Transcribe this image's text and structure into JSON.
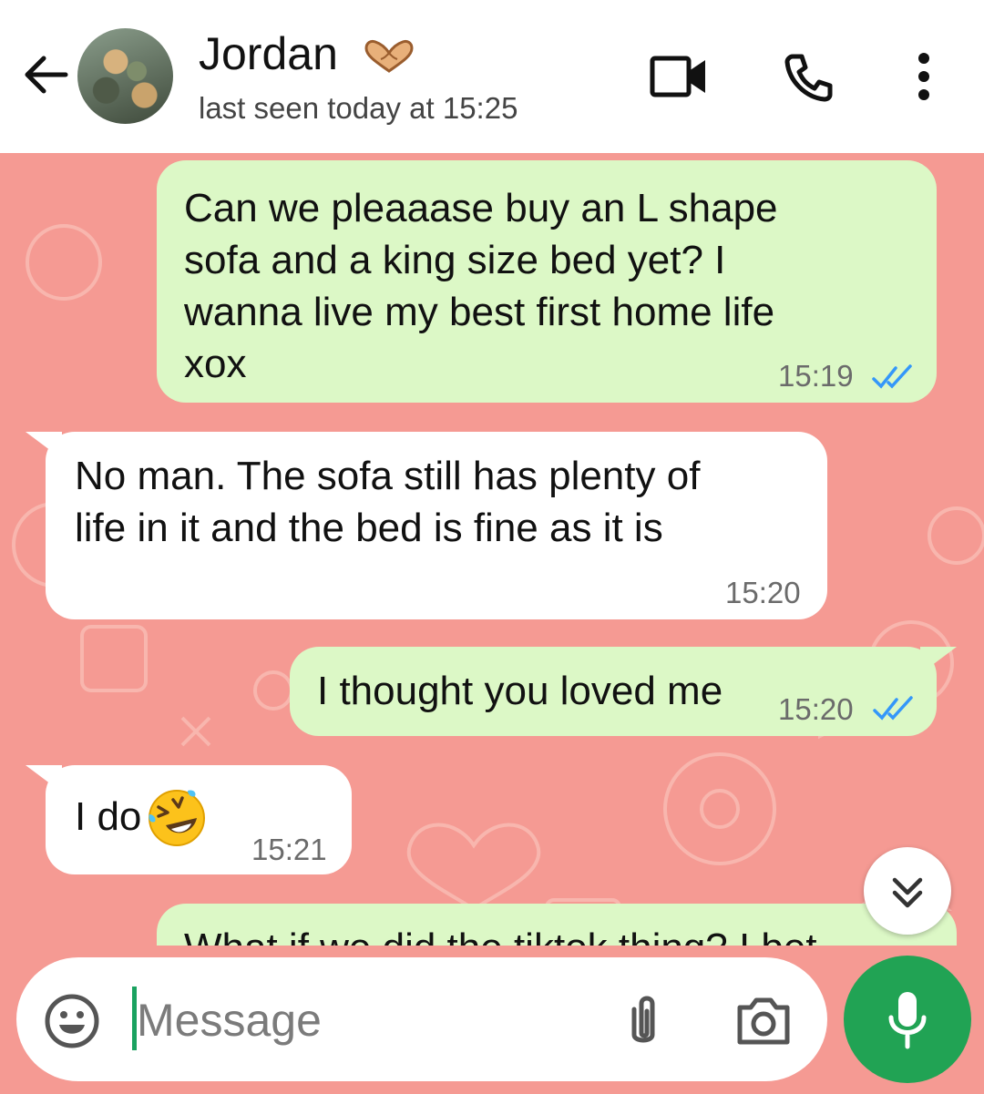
{
  "header": {
    "contact_name": "Jordan",
    "status": "last seen today at 15:25",
    "icons": [
      "back-arrow-icon",
      "heart-hands-icon",
      "video-call-icon",
      "voice-call-icon",
      "more-options-icon"
    ]
  },
  "messages": [
    {
      "direction": "outgoing",
      "lines": [
        "Can we pleaaase buy an L shape",
        "sofa and a king size bed yet? I",
        "wanna live my best first home life",
        "xox"
      ],
      "time": "15:19",
      "read": true
    },
    {
      "direction": "incoming",
      "lines": [
        "No man. The sofa still has plenty of",
        "life in it and the bed is fine as it is"
      ],
      "time": "15:20"
    },
    {
      "direction": "outgoing",
      "lines": [
        "I thought you loved me"
      ],
      "time": "15:20",
      "read": true
    },
    {
      "direction": "incoming",
      "lines": [
        "I do"
      ],
      "emoji": "rolling-on-floor-laughing-emoji",
      "time": "15:21"
    },
    {
      "direction": "outgoing",
      "lines": [
        "What if we did the tiktok thing? I bet"
      ],
      "partial": true
    }
  ],
  "composer": {
    "placeholder": "Message",
    "icons": [
      "emoji-icon",
      "attach-icon",
      "camera-icon",
      "mic-icon"
    ]
  },
  "colors": {
    "wallpaper": "#f59a93",
    "outgoing_bubble": "#dcf8c6",
    "incoming_bubble": "#ffffff",
    "read_ticks": "#3497f9",
    "mic_button": "#21a354"
  }
}
